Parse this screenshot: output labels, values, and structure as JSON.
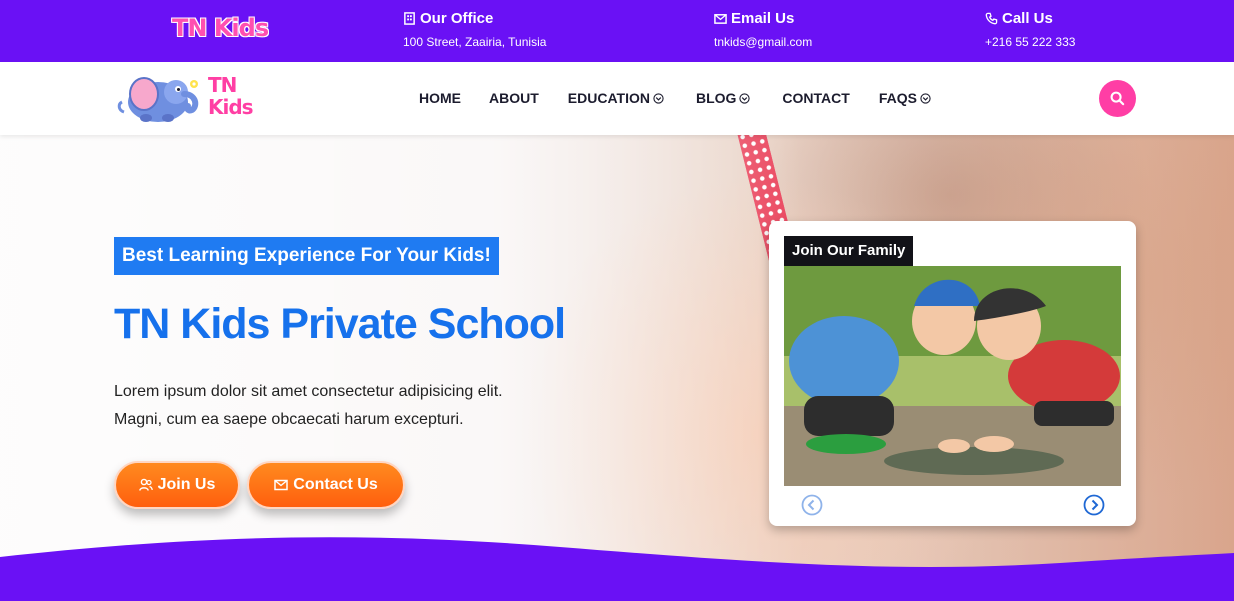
{
  "topbar": {
    "brand": "TN Kids",
    "office": {
      "title": "Our Office",
      "value": "100 Street, Zaairia, Tunisia"
    },
    "email": {
      "title": "Email Us",
      "value": "tnkids@gmail.com"
    },
    "call": {
      "title": "Call Us",
      "value": "+216 55 222 333"
    }
  },
  "nav": {
    "logo_text_1": "TN",
    "logo_text_2": "Kids",
    "items": [
      {
        "label": "HOME"
      },
      {
        "label": "ABOUT"
      },
      {
        "label": "EDUCATION"
      },
      {
        "label": "BLOG"
      },
      {
        "label": "CONTACT"
      },
      {
        "label": "FAQS"
      }
    ]
  },
  "hero": {
    "kicker": "Best Learning Experience For Your Kids!",
    "title": "TN Kids Private School",
    "lead_1": "Lorem ipsum dolor sit amet consectetur adipisicing elit.",
    "lead_2": "Magni, cum ea saepe obcaecati harum excepturi.",
    "join_label": "Join Us",
    "contact_label": "Contact Us"
  },
  "card": {
    "tag": "Join Our Family"
  },
  "colors": {
    "topbar": "#6a11f5",
    "accent_blue": "#1671ec",
    "accent_pink": "#ff3ea5",
    "button_orange": "#ff6a12"
  },
  "icons": {
    "office": "building-icon",
    "email": "mail-icon",
    "call": "phone-icon",
    "search": "search-icon",
    "join": "users-icon",
    "contact": "envelope-icon",
    "prev": "chevron-left-circle-icon",
    "next": "chevron-right-circle-icon"
  }
}
